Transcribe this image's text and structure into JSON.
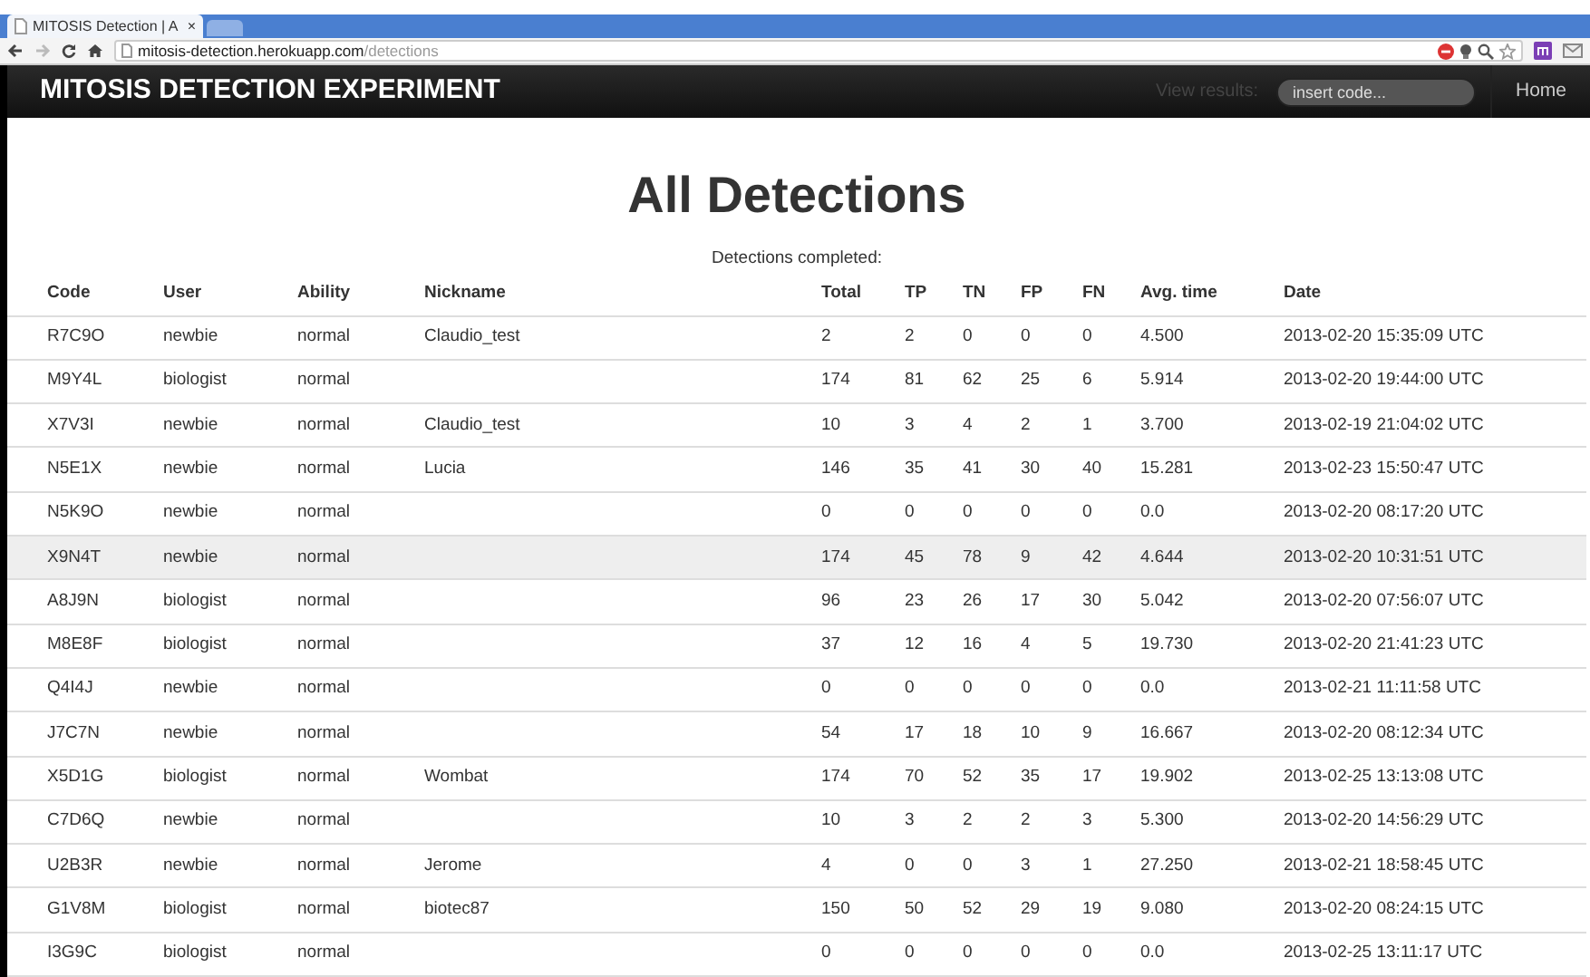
{
  "browser": {
    "tab": {
      "title": "MITOSIS Detection | A",
      "close": "×"
    },
    "url": {
      "host": "mitosis-detection.herokuapp.com",
      "path": "/detections"
    }
  },
  "navbar": {
    "brand": "MITOSIS DETECTION EXPERIMENT",
    "view_label": "View results:",
    "code_field": {
      "placeholder": "insert code..."
    },
    "home": "Home"
  },
  "heading": "All Detections",
  "caption": "Detections completed:",
  "table": {
    "columns": [
      "Code",
      "User",
      "Ability",
      "Nickname",
      "Total",
      "TP",
      "TN",
      "FP",
      "FN",
      "Avg. time",
      "Date"
    ],
    "rows": [
      {
        "cells": [
          "R7C9O",
          "newbie",
          "normal",
          "Claudio_test",
          "2",
          "2",
          "0",
          "0",
          "0",
          "4.500",
          "2013-02-20 15:35:09 UTC"
        ],
        "highlighted": false
      },
      {
        "cells": [
          "M9Y4L",
          "biologist",
          "normal",
          "",
          "174",
          "81",
          "62",
          "25",
          "6",
          "5.914",
          "2013-02-20 19:44:00 UTC"
        ],
        "highlighted": false
      },
      {
        "cells": [
          "X7V3I",
          "newbie",
          "normal",
          "Claudio_test",
          "10",
          "3",
          "4",
          "2",
          "1",
          "3.700",
          "2013-02-19 21:04:02 UTC"
        ],
        "highlighted": false
      },
      {
        "cells": [
          "N5E1X",
          "newbie",
          "normal",
          "Lucia",
          "146",
          "35",
          "41",
          "30",
          "40",
          "15.281",
          "2013-02-23 15:50:47 UTC"
        ],
        "highlighted": false
      },
      {
        "cells": [
          "N5K9O",
          "newbie",
          "normal",
          "",
          "0",
          "0",
          "0",
          "0",
          "0",
          "0.0",
          "2013-02-20 08:17:20 UTC"
        ],
        "highlighted": false
      },
      {
        "cells": [
          "X9N4T",
          "newbie",
          "normal",
          "",
          "174",
          "45",
          "78",
          "9",
          "42",
          "4.644",
          "2013-02-20 10:31:51 UTC"
        ],
        "highlighted": true
      },
      {
        "cells": [
          "A8J9N",
          "biologist",
          "normal",
          "",
          "96",
          "23",
          "26",
          "17",
          "30",
          "5.042",
          "2013-02-20 07:56:07 UTC"
        ],
        "highlighted": false
      },
      {
        "cells": [
          "M8E8F",
          "biologist",
          "normal",
          "",
          "37",
          "12",
          "16",
          "4",
          "5",
          "19.730",
          "2013-02-20 21:41:23 UTC"
        ],
        "highlighted": false
      },
      {
        "cells": [
          "Q4I4J",
          "newbie",
          "normal",
          "",
          "0",
          "0",
          "0",
          "0",
          "0",
          "0.0",
          "2013-02-21 11:11:58 UTC"
        ],
        "highlighted": false
      },
      {
        "cells": [
          "J7C7N",
          "newbie",
          "normal",
          "",
          "54",
          "17",
          "18",
          "10",
          "9",
          "16.667",
          "2013-02-20 08:12:34 UTC"
        ],
        "highlighted": false
      },
      {
        "cells": [
          "X5D1G",
          "biologist",
          "normal",
          "Wombat",
          "174",
          "70",
          "52",
          "35",
          "17",
          "19.902",
          "2013-02-25 13:13:08 UTC"
        ],
        "highlighted": false
      },
      {
        "cells": [
          "C7D6Q",
          "newbie",
          "normal",
          "",
          "10",
          "3",
          "2",
          "2",
          "3",
          "5.300",
          "2013-02-20 14:56:29 UTC"
        ],
        "highlighted": false
      },
      {
        "cells": [
          "U2B3R",
          "newbie",
          "normal",
          "Jerome",
          "4",
          "0",
          "0",
          "3",
          "1",
          "27.250",
          "2013-02-21 18:58:45 UTC"
        ],
        "highlighted": false
      },
      {
        "cells": [
          "G1V8M",
          "biologist",
          "normal",
          "biotec87",
          "150",
          "50",
          "52",
          "29",
          "19",
          "9.080",
          "2013-02-20 08:24:15 UTC"
        ],
        "highlighted": false
      },
      {
        "cells": [
          "I3G9C",
          "biologist",
          "normal",
          "",
          "0",
          "0",
          "0",
          "0",
          "0",
          "0.0",
          "2013-02-25 13:11:17 UTC"
        ],
        "highlighted": false
      }
    ]
  }
}
